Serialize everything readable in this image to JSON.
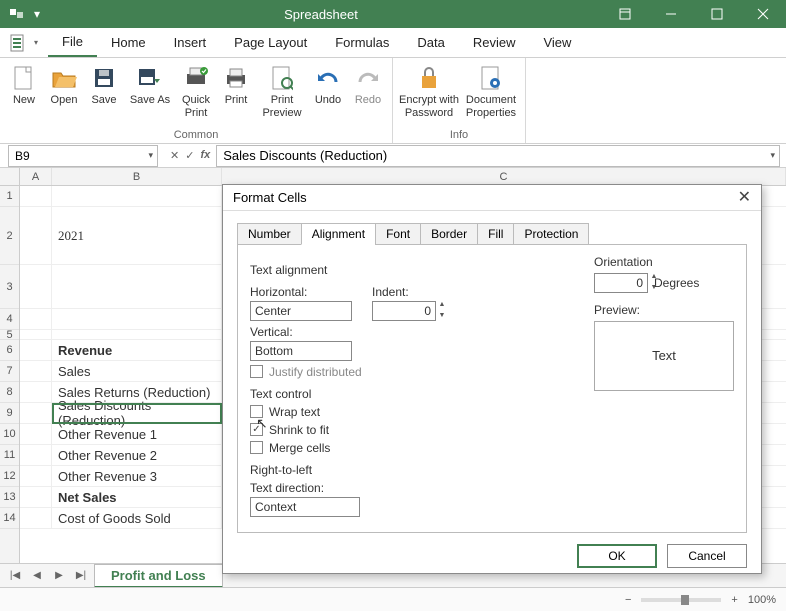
{
  "titlebar": {
    "title": "Spreadsheet"
  },
  "menu": {
    "file": "File",
    "home": "Home",
    "insert": "Insert",
    "pagelayout": "Page Layout",
    "formulas": "Formulas",
    "data": "Data",
    "review": "Review",
    "view": "View"
  },
  "ribbon": {
    "new": "New",
    "open": "Open",
    "save": "Save",
    "saveas": "Save As",
    "quickprint": "Quick Print",
    "print": "Print",
    "printpreview": "Print Preview",
    "undo": "Undo",
    "redo": "Redo",
    "encrypt": "Encrypt with Password",
    "docprops": "Document Properties",
    "group_common": "Common",
    "group_info": "Info"
  },
  "fbar": {
    "cellref": "B9",
    "formula": "Sales Discounts (Reduction)"
  },
  "cols": {
    "A": "A",
    "B": "B",
    "C": "C"
  },
  "rows": {
    "r1": "1",
    "r2": "2",
    "r3": "3",
    "r4": "4",
    "r5": "5",
    "r6": "6",
    "r7": "7",
    "r8": "8",
    "r9": "9",
    "r10": "10",
    "r11": "11",
    "r12": "12",
    "r13": "13",
    "r14": "14"
  },
  "gridvals": {
    "year": "2021",
    "revenue_hdr": "Revenue",
    "sales": "Sales",
    "sales_returns": "Sales Returns (Reduction)",
    "sales_discounts": "Sales Discounts (Reduction)",
    "other_rev1": "Other Revenue 1",
    "other_rev2": "Other Revenue 2",
    "other_rev3": "Other Revenue 3",
    "net_sales": "Net Sales",
    "cogs": "Cost of Goods Sold"
  },
  "sheet": {
    "nav_first": "|◀",
    "nav_prev": "◀",
    "nav_next": "▶",
    "nav_last": "▶|",
    "tab": "Profit and Loss"
  },
  "status": {
    "minus": "−",
    "plus": "+",
    "zoom": "100%"
  },
  "dialog": {
    "title": "Format Cells",
    "tabs": {
      "number": "Number",
      "alignment": "Alignment",
      "font": "Font",
      "border": "Border",
      "fill": "Fill",
      "protection": "Protection"
    },
    "text_alignment_hdr": "Text alignment",
    "horizontal_lbl": "Horizontal:",
    "horizontal_val": "Center",
    "indent_lbl": "Indent:",
    "indent_val": "0",
    "vertical_lbl": "Vertical:",
    "vertical_val": "Bottom",
    "justify_dist": "Justify distributed",
    "text_control_hdr": "Text control",
    "wrap": "Wrap text",
    "shrink": "Shrink to fit",
    "merge": "Merge cells",
    "rtl_hdr": "Right-to-left",
    "textdir_lbl": "Text direction:",
    "textdir_val": "Context",
    "orientation_lbl": "Orientation",
    "orientation_val": "0",
    "degrees": "Degrees",
    "preview_lbl": "Preview:",
    "preview_text": "Text",
    "ok": "OK",
    "cancel": "Cancel",
    "shrink_checked": "✓"
  }
}
